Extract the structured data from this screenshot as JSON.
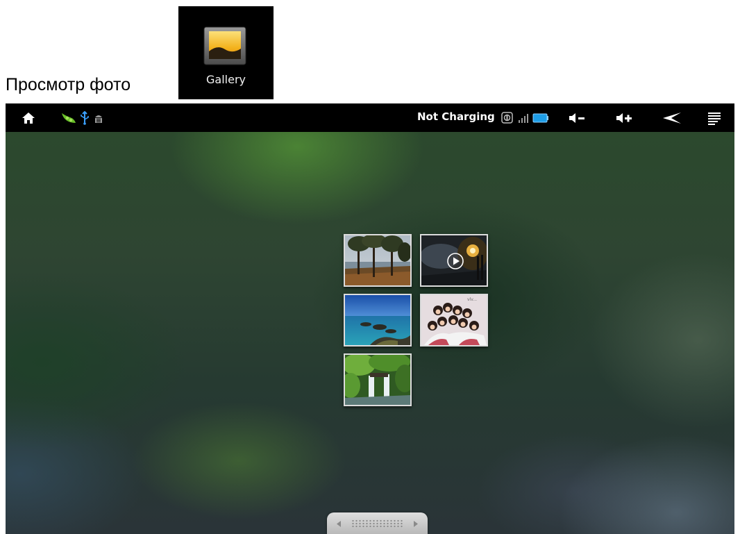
{
  "caption": "Просмотр фото",
  "app_icon": {
    "label": "Gallery",
    "icon": "gallery-landscape-icon"
  },
  "status_bar": {
    "left_icons": [
      "home-icon",
      "pea-pod-icon",
      "usb-icon",
      "android-debug-icon"
    ],
    "status_text": "Not Charging",
    "right_icons": [
      "sync-icon",
      "signal-icon",
      "battery-icon",
      "volume-down-icon",
      "volume-up-icon",
      "back-icon",
      "menu-icon"
    ]
  },
  "albums": [
    {
      "name": "album-trees-lake",
      "has_video": false
    },
    {
      "name": "album-night-video",
      "has_video": true
    },
    {
      "name": "album-sea-rocks",
      "has_video": false
    },
    {
      "name": "album-group-photo",
      "has_video": false,
      "text": "vlv..."
    },
    {
      "name": "album-waterfall",
      "has_video": false
    }
  ],
  "scroll_handle": {
    "left_icon": "arrow-left-icon",
    "right_icon": "arrow-right-icon"
  },
  "colors": {
    "status_bar": "#000000",
    "status_text": "#ffffff",
    "battery": "#1e9ee8",
    "usb": "#3aa0ff",
    "pea_pod": "#6ac02a",
    "gallery_icon": "#f2b21a"
  }
}
